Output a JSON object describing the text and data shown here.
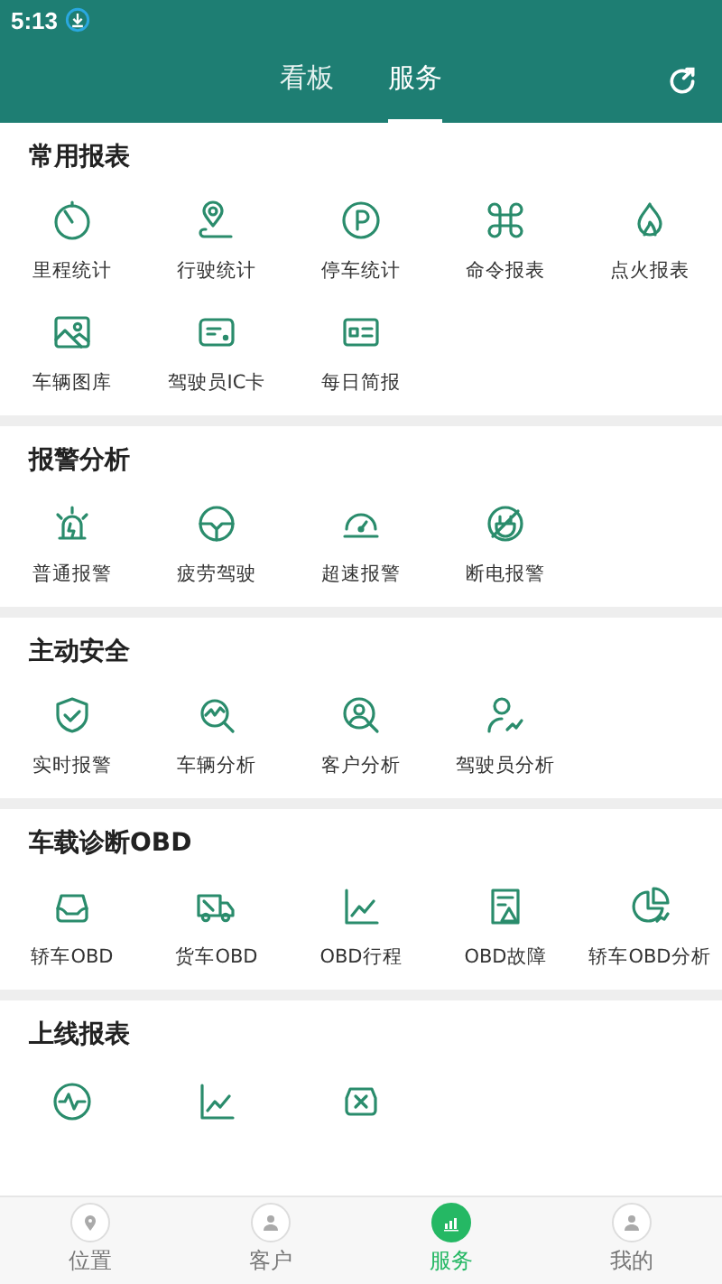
{
  "status_bar": {
    "time": "5:13"
  },
  "header": {
    "tabs": [
      {
        "label": "看板",
        "selected": false
      },
      {
        "label": "服务",
        "selected": true
      }
    ]
  },
  "sections": [
    {
      "title": "常用报表",
      "items": [
        {
          "label": "里程统计"
        },
        {
          "label": "行驶统计"
        },
        {
          "label": "停车统计"
        },
        {
          "label": "命令报表"
        },
        {
          "label": "点火报表"
        },
        {
          "label": "车辆图库"
        },
        {
          "label": "驾驶员IC卡"
        },
        {
          "label": "每日简报"
        }
      ]
    },
    {
      "title": "报警分析",
      "items": [
        {
          "label": "普通报警"
        },
        {
          "label": "疲劳驾驶"
        },
        {
          "label": "超速报警"
        },
        {
          "label": "断电报警"
        }
      ]
    },
    {
      "title": "主动安全",
      "items": [
        {
          "label": "实时报警"
        },
        {
          "label": "车辆分析"
        },
        {
          "label": "客户分析"
        },
        {
          "label": "驾驶员分析"
        }
      ]
    },
    {
      "title": "车载诊断OBD",
      "items": [
        {
          "label": "轿车OBD"
        },
        {
          "label": "货车OBD"
        },
        {
          "label": "OBD行程"
        },
        {
          "label": "OBD故障"
        },
        {
          "label": "轿车OBD分析"
        }
      ]
    },
    {
      "title": "上线报表",
      "kind": "icons",
      "items": [
        {
          "kind": "icon"
        },
        {
          "kind": "icon"
        },
        {
          "kind": "icon"
        }
      ]
    }
  ],
  "bottom_nav": [
    {
      "label": "位置",
      "selected": false
    },
    {
      "label": "客户",
      "selected": false
    },
    {
      "label": "服务",
      "selected": true
    },
    {
      "label": "我的",
      "selected": false
    }
  ]
}
